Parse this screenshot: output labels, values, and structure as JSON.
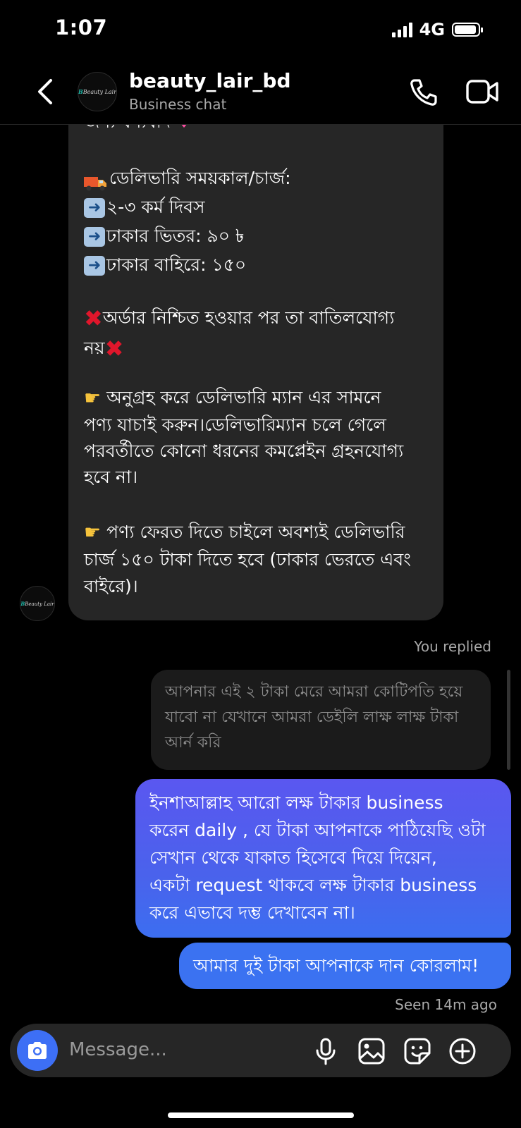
{
  "status_bar": {
    "time": "1:07",
    "network": "4G"
  },
  "header": {
    "name": "beauty_lair_bd",
    "subtitle": "Business chat",
    "logo_text": "Beauty Lair"
  },
  "incoming": {
    "top_cut": "জন্য ধন্যবাদ",
    "delivery_title": "ডেলিভারি সময়কাল/চার্জ:",
    "delivery_items": [
      "২-৩ কর্ম দিবস",
      "ঢাকার ভিতর: ৯০ ৳",
      "ঢাকার বাহিরে: ১৫০"
    ],
    "cancel_line1": "অর্ডার নিশ্চিত হওয়ার পর তা বাতিলযোগ্য",
    "cancel_line2": "নয়",
    "check_lines": [
      "অনুগ্রহ করে ডেলিভারি ম্যান এর সামনে",
      "পণ্য যাচাই করুন।ডেলিভারিম্যান চলে গেলে",
      "পরবর্তীতে কোনো ধরনের কমপ্লেইন গ্রহনযোগ্য",
      "হবে না।"
    ],
    "return_lines": [
      "পণ্য ফেরত দিতে চাইলে অবশ্যই ডেলিভারি",
      "চার্জ ১৫০ টাকা দিতে হবে (ঢাকার ভেরতে এবং",
      "বাইরে)।"
    ]
  },
  "you_replied": "You replied",
  "quoted_reply": [
    "আপনার এই ২ টাকা মেরে আমরা কোটিপতি হয়ে",
    "যাবো না যেখানে আমরা ডেইলি লাক্ষ লাক্ষ টাকা",
    "আর্ন করি"
  ],
  "outgoing_1": [
    "ইনশাআল্লাহ আরো লক্ষ টাকার business",
    "করেন daily , যে টাকা আপনাকে পাঠিয়েছি ওটা",
    "সেখান থেকে যাকাত হিসেবে দিয়ে দিয়েন,",
    "একটা request থাকবে লক্ষ টাকার business",
    "করে এভাবে দম্ভ দেখাবেন না।"
  ],
  "outgoing_2": "আমার দুই টাকা আপনাকে দান কোরলাম!",
  "seen": "Seen 14m ago",
  "composer": {
    "placeholder": "Message..."
  },
  "icons": [
    "back-icon",
    "phone-icon",
    "video-icon",
    "camera-icon",
    "microphone-icon",
    "gallery-icon",
    "sticker-icon",
    "plus-icon"
  ]
}
